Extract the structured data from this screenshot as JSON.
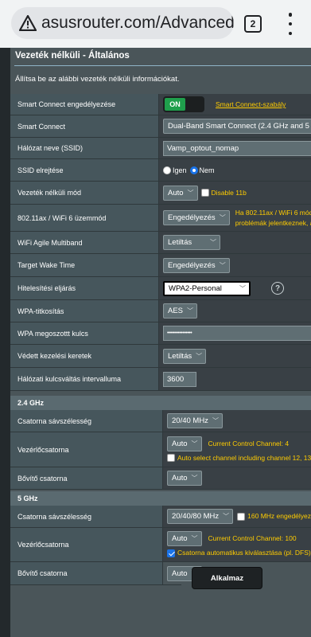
{
  "browser": {
    "url": "asusrouter.com/Advanced_Wirel",
    "tab_count": "2"
  },
  "panel": {
    "title": "Vezeték nélküli - Általános",
    "description": "Állítsa be az alábbi vezeték nélküli információkat."
  },
  "rows": {
    "smart_connect_enable": {
      "label": "Smart Connect engedélyezése",
      "toggle": "ON",
      "link": "Smart Connect-szabály"
    },
    "smart_connect": {
      "label": "Smart Connect",
      "value": "Dual-Band Smart Connect (2.4 GHz and 5 GHz)"
    },
    "ssid": {
      "label": "Hálózat neve (SSID)",
      "value": "Vamp_optout_nomap"
    },
    "hide_ssid": {
      "label": "SSID elrejtése",
      "opt_yes": "Igen",
      "opt_no": "Nem"
    },
    "wireless_mode": {
      "label": "Vezeték nélküli mód",
      "value": "Auto",
      "checkbox": "Disable 11b"
    },
    "ax_mode": {
      "label": "802.11ax / WiFi 6 üzemmód",
      "value": "Engedélyezés",
      "warn1": "Ha 802.11ax / WiFi 6 mód engedélyezve",
      "warn2": "problémák jelentkeznek, akkor"
    },
    "agile_multiband": {
      "label": "WiFi Agile Multiband",
      "value": "Letiltás"
    },
    "target_wake": {
      "label": "Target Wake Time",
      "value": "Engedélyezés"
    },
    "auth_method": {
      "label": "Hitelesítési eljárás",
      "value": "WPA2-Personal",
      "help": "?"
    },
    "wpa_encryption": {
      "label": "WPA-titkosítás",
      "value": "AES"
    },
    "wpa_key": {
      "label": "WPA megoszottt kulcs",
      "value": "••••••••••••••••"
    },
    "pmf": {
      "label": "Védett kezelési keretek",
      "value": "Letiltás"
    },
    "key_rotation": {
      "label": "Hálózati kulcsváltás intervalluma",
      "value": "3600"
    }
  },
  "band_24": {
    "header": "2.4 GHz",
    "bandwidth": {
      "label": "Csatorna sávszélesség",
      "value": "20/40 MHz"
    },
    "control_channel": {
      "label": "Vezérlőcsatorna",
      "value": "Auto",
      "current": "Current Control Channel: 4",
      "checkbox": "Auto select channel including channel 12, 13"
    },
    "extension": {
      "label": "Bővítő csatorna",
      "value": "Auto"
    }
  },
  "band_5": {
    "header": "5 GHz",
    "bandwidth": {
      "label": "Csatorna sávszélesség",
      "value": "20/40/80 MHz",
      "checkbox": "160 MHz engedélyezése"
    },
    "control_channel": {
      "label": "Vezérlőcsatorna",
      "value": "Auto",
      "current": "Current Control Channel: 100",
      "checkbox": "Csatorna automatikus kiválasztása (pl. DFS)"
    },
    "extension": {
      "label": "Bővítő csatorna",
      "value": "Auto"
    }
  },
  "apply_button": "Alkalmaz",
  "colors": {
    "accent_yellow": "#ffcc00",
    "toggle_green": "#1f9f4c",
    "panel_bg": "#4a5559",
    "checkbox_blue": "#1a73e8"
  }
}
